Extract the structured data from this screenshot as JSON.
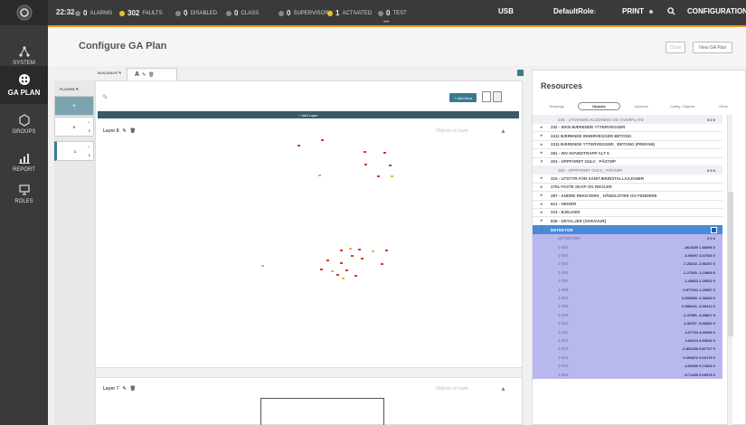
{
  "topbar": {
    "time": "22:32",
    "alarms": {
      "count": "0",
      "label": "ALARMS"
    },
    "faults": {
      "count": "302",
      "label": "FAULTS"
    },
    "disabled": {
      "count": "0",
      "label": "DISABLED"
    },
    "class": {
      "count": "0",
      "label": "CLASS"
    },
    "supervisory": {
      "count": "0",
      "label": "SUPERVISORY"
    },
    "activated": {
      "count": "1",
      "label": "ACTIVATED"
    },
    "test": {
      "count": "0",
      "label": "TEST"
    },
    "usb": "USB",
    "role": "DefaultRole",
    "print": "PRINT",
    "configuration": "CONFIGURATION",
    "dots": "•••",
    "colors": {
      "faults": "#e8c21f",
      "activated": "#e8c21f",
      "accent": "#f29a1f"
    }
  },
  "nav": [
    {
      "label": "SYSTEM",
      "icon": "system-icon"
    },
    {
      "label": "GA PLAN",
      "icon": "ga-plan-icon"
    },
    {
      "label": "GROUPS",
      "icon": "groups-icon"
    },
    {
      "label": "REPORT",
      "icon": "report-icon"
    },
    {
      "label": "ROLES",
      "icon": "roles-icon"
    }
  ],
  "header": {
    "title": "Configure GA Plan",
    "close_label": "Close",
    "view_label": "View GA Plan"
  },
  "tabs": {
    "buildings_label": "BUILDINGS",
    "building": "A"
  },
  "floors": {
    "label": "FLOORS",
    "add": "+",
    "items": [
      {
        "num": "0",
        "sub": "0"
      },
      {
        "num": "1",
        "sub": "0"
      }
    ]
  },
  "canvas": {
    "add_area": "+ Add Area",
    "add_layer": "+ Add Layer",
    "layers": [
      {
        "name": "Layer 8",
        "status": "Objects on layer"
      },
      {
        "name": "Layer 7",
        "status": "Objects on layer"
      }
    ]
  },
  "resources": {
    "title": "Resources",
    "tabs": [
      "Drawings",
      "Objects",
      "Symbols",
      "Config. Objects",
      "Other"
    ],
    "active_tab": "Objects",
    "rows": [
      {
        "kind": "sub",
        "name": "235 - UTVENDIG KLEDNING OG OVERFLATE",
        "val": "0 0 0"
      },
      {
        "kind": "group",
        "name": "232 - IKKE-BÆRENDE YTTERVEGGER",
        "arrow": "▸"
      },
      {
        "kind": "group",
        "name": "2411 BÆRENDE INNERVEGGER BETONG",
        "arrow": "▸"
      },
      {
        "kind": "group",
        "name": "2311 BÆRENDE YTTERVEGGER_ BETONG (PREFAB)",
        "arrow": "▸"
      },
      {
        "kind": "group",
        "name": "281 - INV HOVEDTRAPP ALT 5",
        "arrow": "▸"
      },
      {
        "kind": "group",
        "name": "253 - OPPFORET GULV_ PÅSTØP",
        "arrow": "▾"
      },
      {
        "kind": "sub",
        "name": "253 - OPPFORET GULV_ PÅSTØP",
        "val": "0 0 0"
      },
      {
        "kind": "group",
        "name": "315 - UTSTYR FOR SANITÆRINSTALLASJONER",
        "arrow": "▸"
      },
      {
        "kind": "group",
        "name": "2751 FASTE SKAP OG REOLER",
        "arrow": "▸"
      },
      {
        "kind": "group",
        "name": "287 - ANDRE REKKVERK_ HÅNDLISTER OG FENDERE",
        "arrow": "▸"
      },
      {
        "kind": "group",
        "name": "621 - HEISER",
        "arrow": "▸"
      },
      {
        "kind": "group",
        "name": "223 - BJELKER",
        "arrow": "▸"
      },
      {
        "kind": "group",
        "name": "838 - DETALJER (SKRAVUR)",
        "arrow": "▸"
      },
      {
        "kind": "dethead",
        "name": "DETEKTOR",
        "arrow": "▾"
      },
      {
        "kind": "dettop",
        "name": "DETEKTOR",
        "val": "0 0 0"
      },
      {
        "kind": "det",
        "name": "1-001",
        "val": "-36.6659 1.85696 0"
      },
      {
        "kind": "det",
        "name": "1-002",
        "val": "-6.96097 4.07533 0"
      },
      {
        "kind": "det",
        "name": "1-003",
        "val": "-7.28215 -2.56257 0"
      },
      {
        "kind": "det",
        "name": "1-004",
        "val": "-1.27335 -1.15968 0"
      },
      {
        "kind": "det",
        "name": "1-005",
        "val": "-1.48863 2.25522 0"
      },
      {
        "kind": "det",
        "name": "1-006",
        "val": "0.877541 1.29967 0"
      },
      {
        "kind": "det",
        "name": "1-007",
        "val": "0.856858 -1.38280 0"
      },
      {
        "kind": "det",
        "name": "1-008",
        "val": "0.388426 -4.36412 0"
      },
      {
        "kind": "det",
        "name": "1-009",
        "val": "-1.47996 -4.35827 0"
      },
      {
        "kind": "det",
        "name": "1-010",
        "val": "4.40757 -5.68382 0"
      },
      {
        "kind": "det",
        "name": "1-011",
        "val": "4.67793 3.40993 0"
      },
      {
        "kind": "det",
        "name": "1-012",
        "val": "4.62614 6.93616 0"
      },
      {
        "kind": "det",
        "name": "1-013",
        "val": "-0.851258 8.87767 0"
      },
      {
        "kind": "det",
        "name": "1-014",
        "val": "0.294872 9.16179 0"
      },
      {
        "kind": "det",
        "name": "1-015",
        "val": "-4.82966 9.71844 0"
      },
      {
        "kind": "det",
        "name": "1-016",
        "val": "-5.71469 9.00578 0"
      }
    ]
  }
}
